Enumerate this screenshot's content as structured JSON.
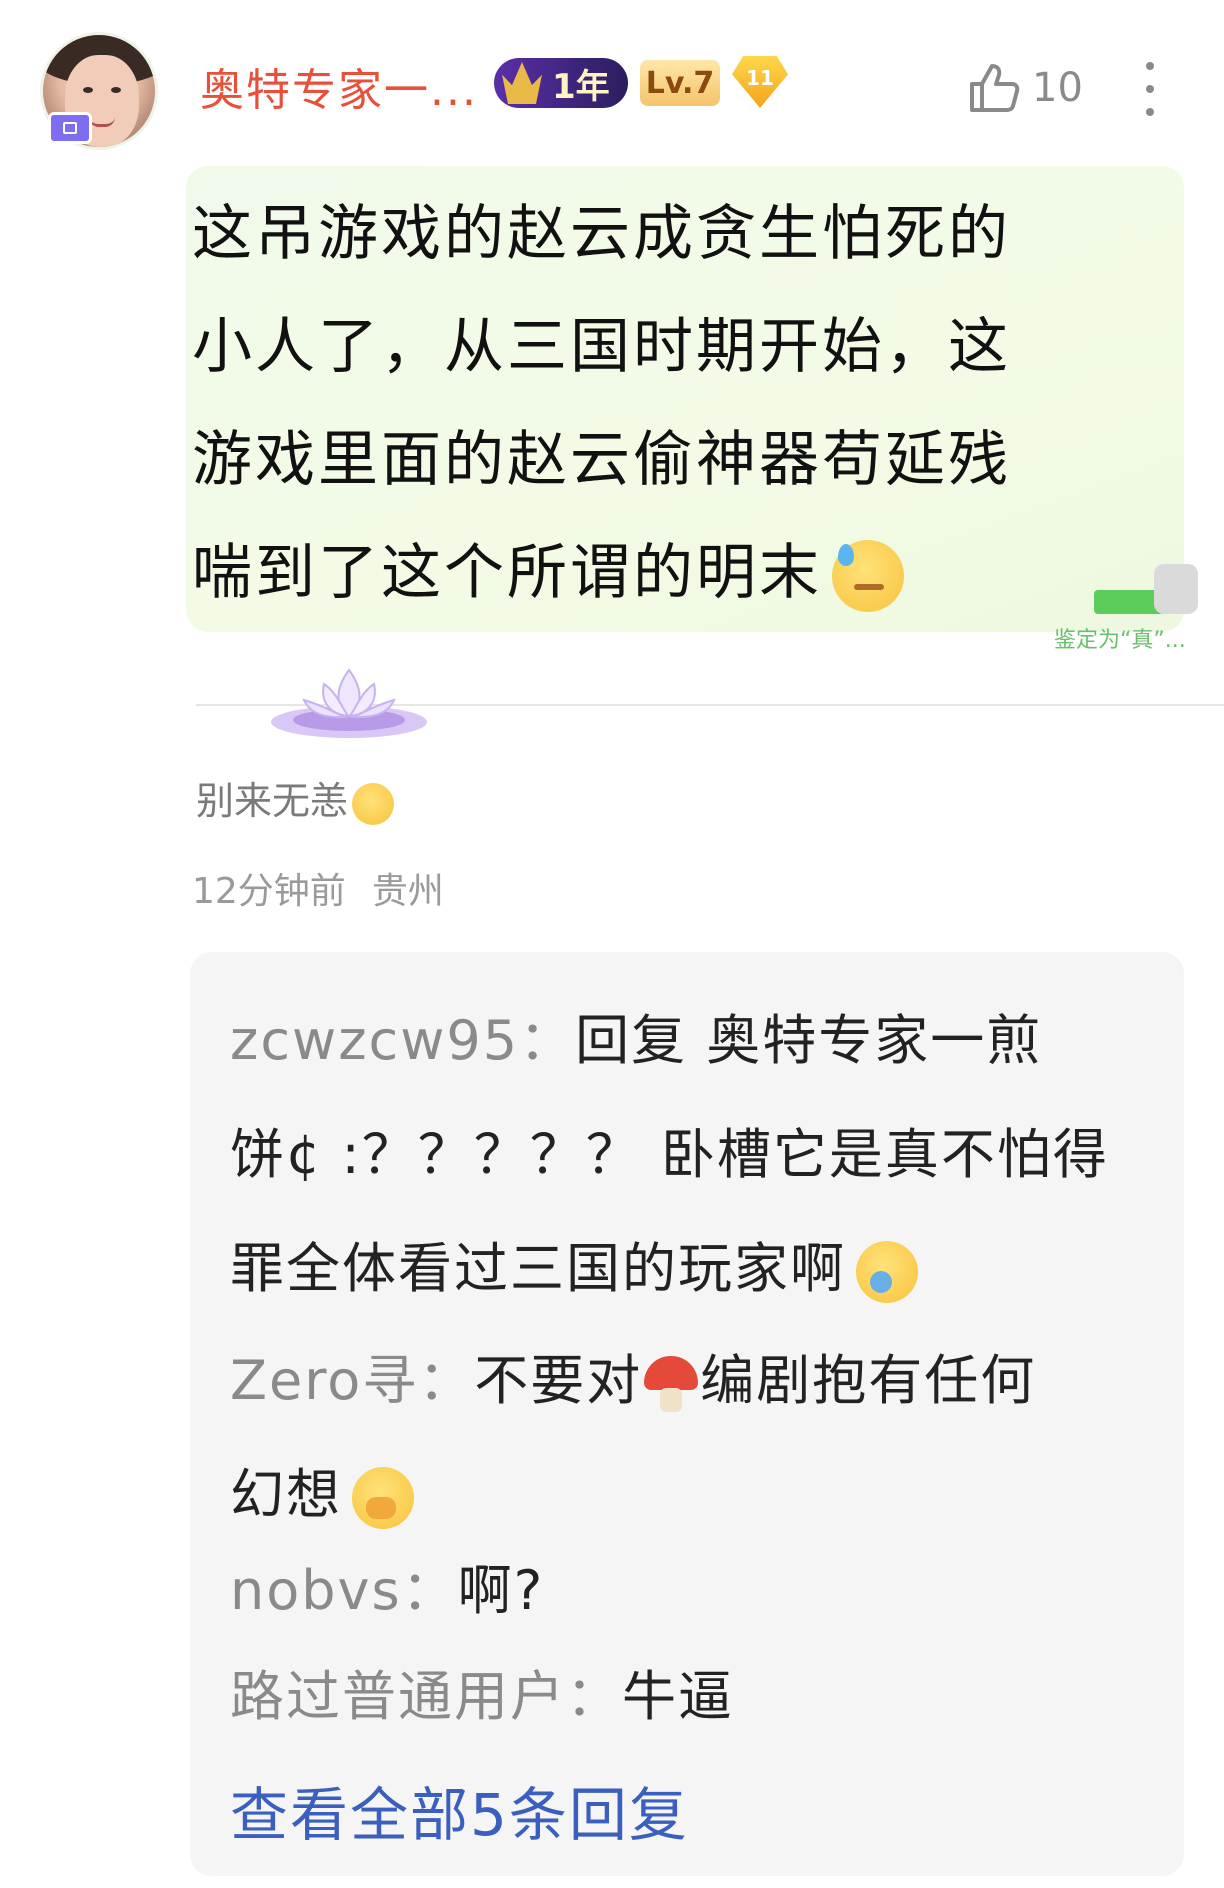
{
  "header": {
    "username": "奥特专家一...",
    "badge_year": "1年",
    "badge_level": "Lv.7",
    "badge_gem": "11",
    "like_count": "10",
    "icons": [
      "avatar-badge-icon",
      "crown-icon",
      "gem-icon",
      "like-icon",
      "more-icon"
    ]
  },
  "comment": {
    "lines": [
      "这吊游戏的赵云成贪生怕死的",
      "小人了，从三国时期开始，这",
      "游戏里面的赵云偷神器苟延残",
      "喘到了这个所谓的明末"
    ],
    "stamp_label": "鉴定为“真”..."
  },
  "signature": "别来无恙",
  "meta": {
    "time": "12分钟前",
    "location": "贵州"
  },
  "replies": [
    {
      "name": "zcwzcw95：",
      "text_line1": "回复 奥特专家一煎",
      "text_line2": "饼¢ :？？？？？ 卧槽它是真不怕得",
      "text_line3": "罪全体看过三国的玩家啊"
    },
    {
      "name": "Zero寻：",
      "text_part1": "不要对",
      "text_part2": "编剧抱有任何",
      "text_line2": "幻想"
    },
    {
      "name": "nobvs：",
      "text": "啊?"
    },
    {
      "name": "路过普通用户：",
      "text": "牛逼"
    }
  ],
  "view_all": "查看全部5条回复",
  "colors": {
    "username": "#e8503a",
    "link": "#3a5fbf",
    "bubble": "#f1faea",
    "replies_bg": "#f5f5f5"
  }
}
